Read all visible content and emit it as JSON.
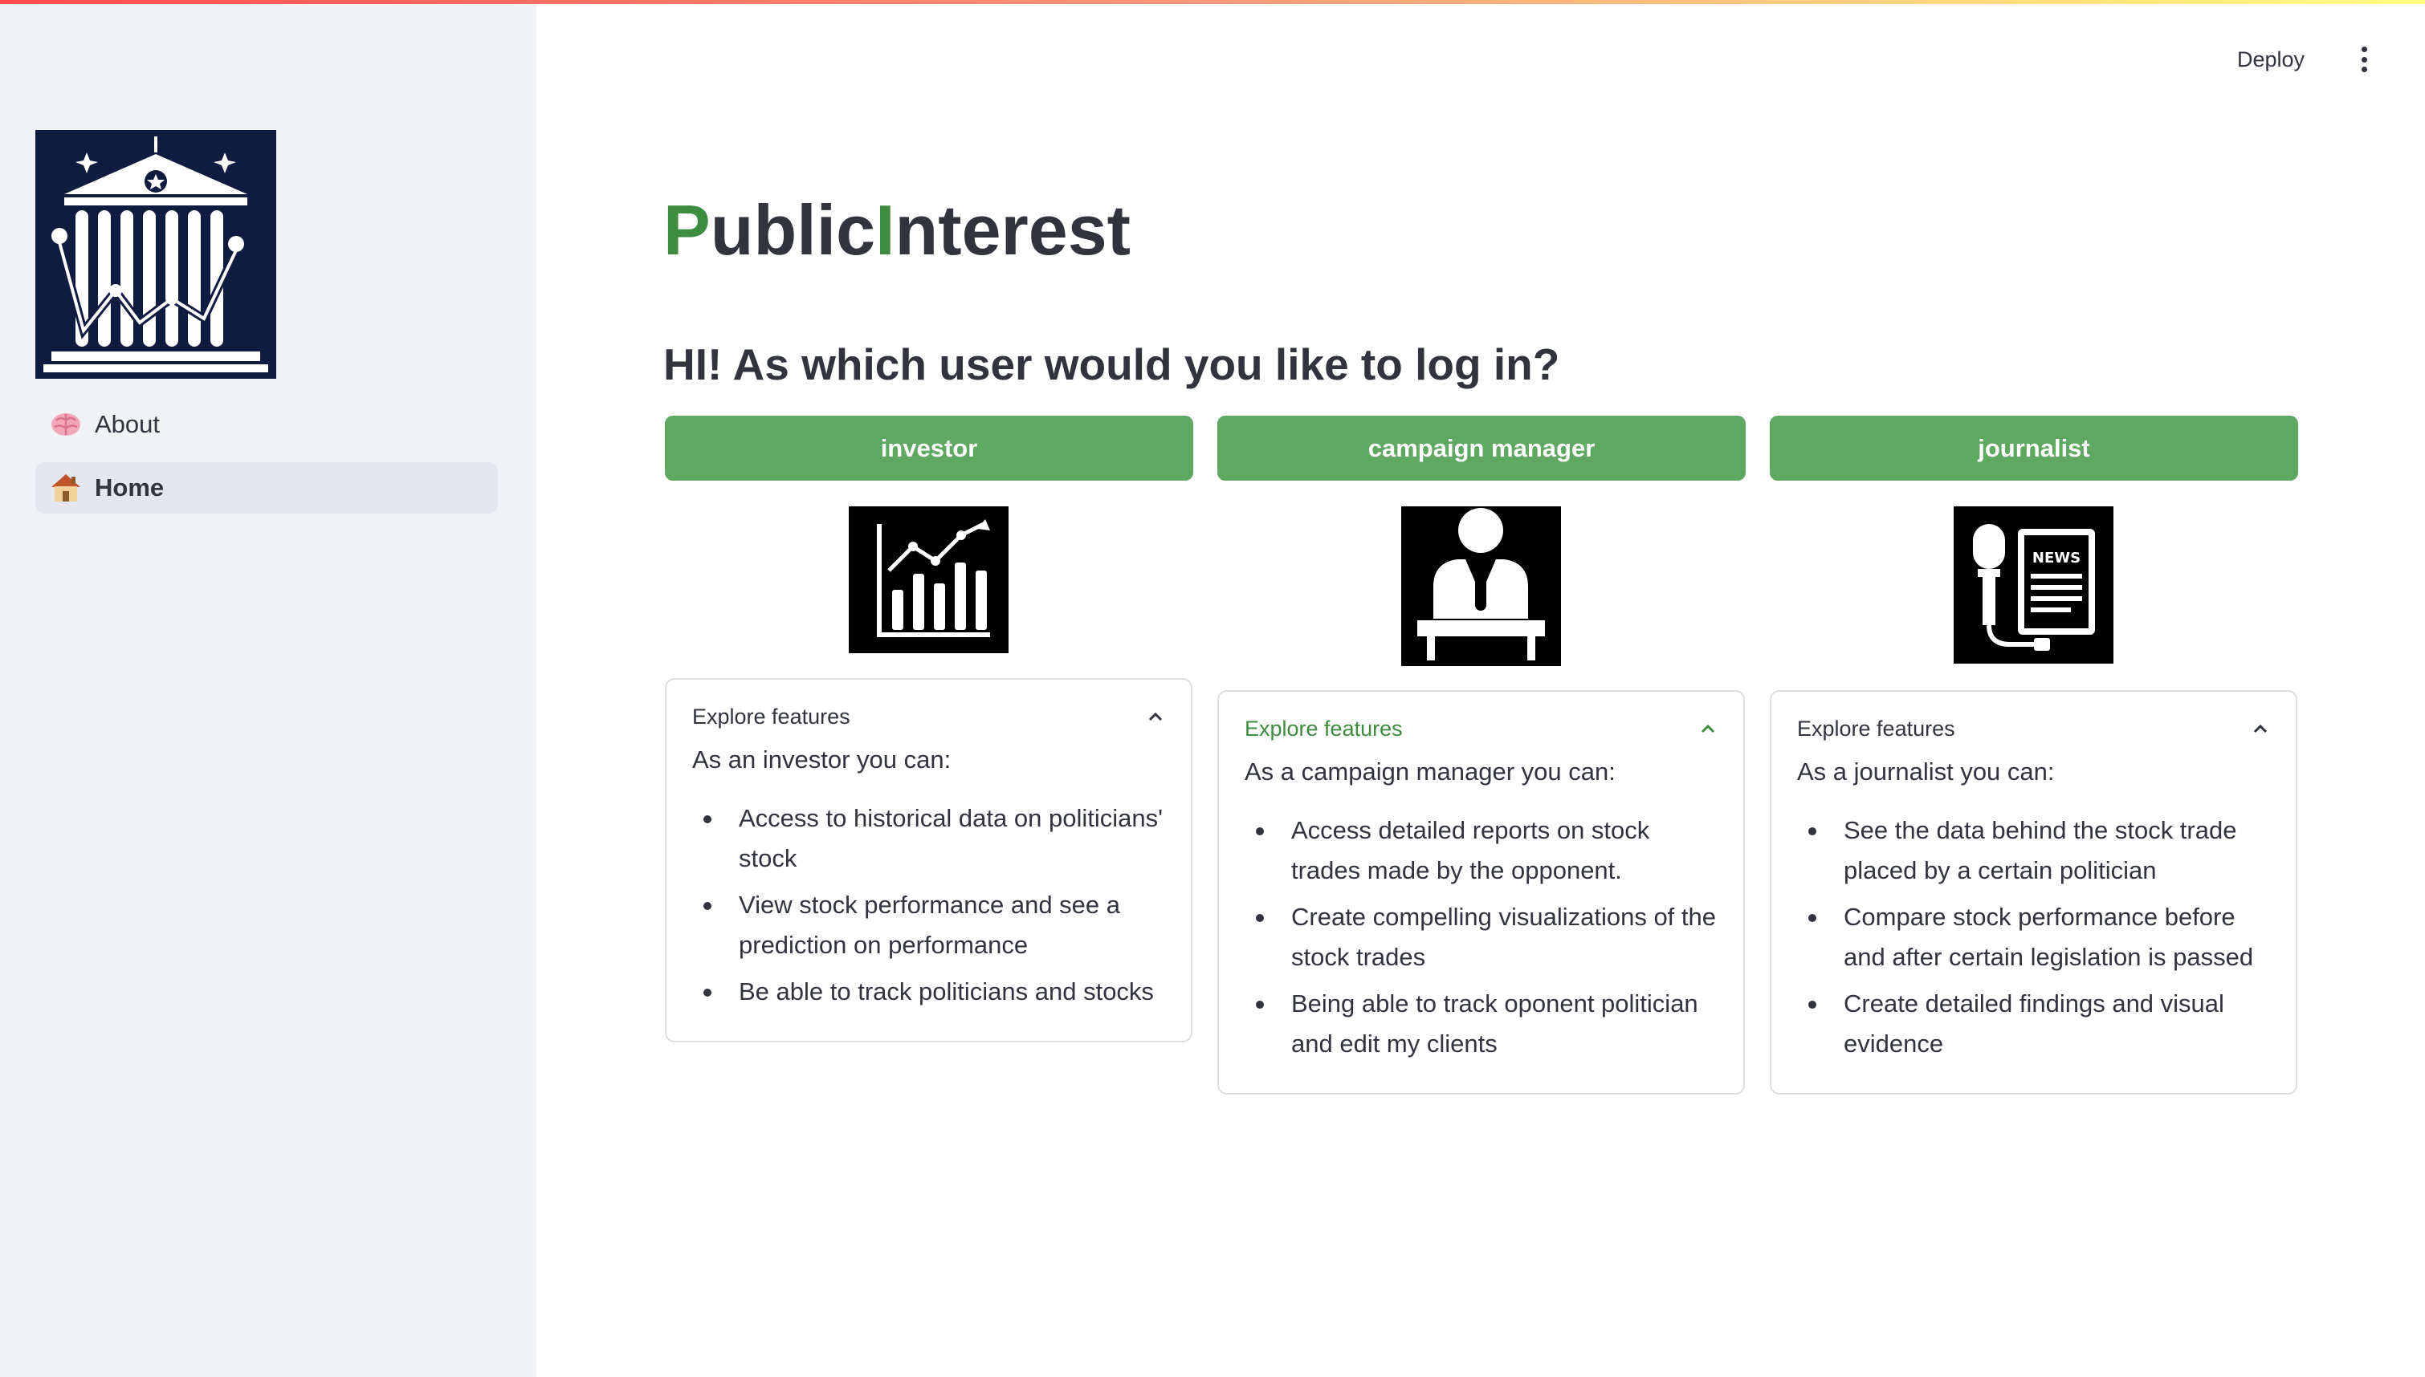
{
  "app": {
    "title_part1_green": "P",
    "title_part2": "ublic",
    "title_part3_green": "I",
    "title_part4": "nterest",
    "prompt": "HI! As which user would you like to log in?"
  },
  "header": {
    "deploy_label": "Deploy"
  },
  "sidebar": {
    "items": [
      {
        "label": "About",
        "emoji": "🧠",
        "active": false
      },
      {
        "label": "Home",
        "emoji": "🏠",
        "active": true
      }
    ]
  },
  "roles": [
    {
      "button": "investor",
      "icon": "chart-icon",
      "expander": {
        "header": "Explore features",
        "intro": "As an investor you can:",
        "items": [
          "Access to historical data on politicians' stock",
          "View stock performance and see a prediction on performance",
          "Be able to track politicians and stocks"
        ]
      }
    },
    {
      "button": "campaign manager",
      "icon": "speaker-podium-icon",
      "expander": {
        "header": "Explore features",
        "intro": "As a campaign manager you can:",
        "items": [
          "Access detailed reports on stock trades made by the opponent.",
          "Create compelling visualizations of the stock trades",
          "Being able to track oponent politician and edit my clients"
        ]
      }
    },
    {
      "button": "journalist",
      "icon": "news-microphone-icon",
      "expander": {
        "header": "Explore features",
        "intro": "As a journalist you can:",
        "items": [
          "See the data behind the stock trade placed by a certain politician",
          "Compare stock performance before and after certain legislation is passed",
          "Create detailed findings and visual evidence"
        ]
      }
    }
  ],
  "colors": {
    "accent_green": "#3d8c40",
    "button_green": "#5fa862",
    "sidebar_bg": "#f0f2f6",
    "logo_bg": "#0f1c3f"
  }
}
